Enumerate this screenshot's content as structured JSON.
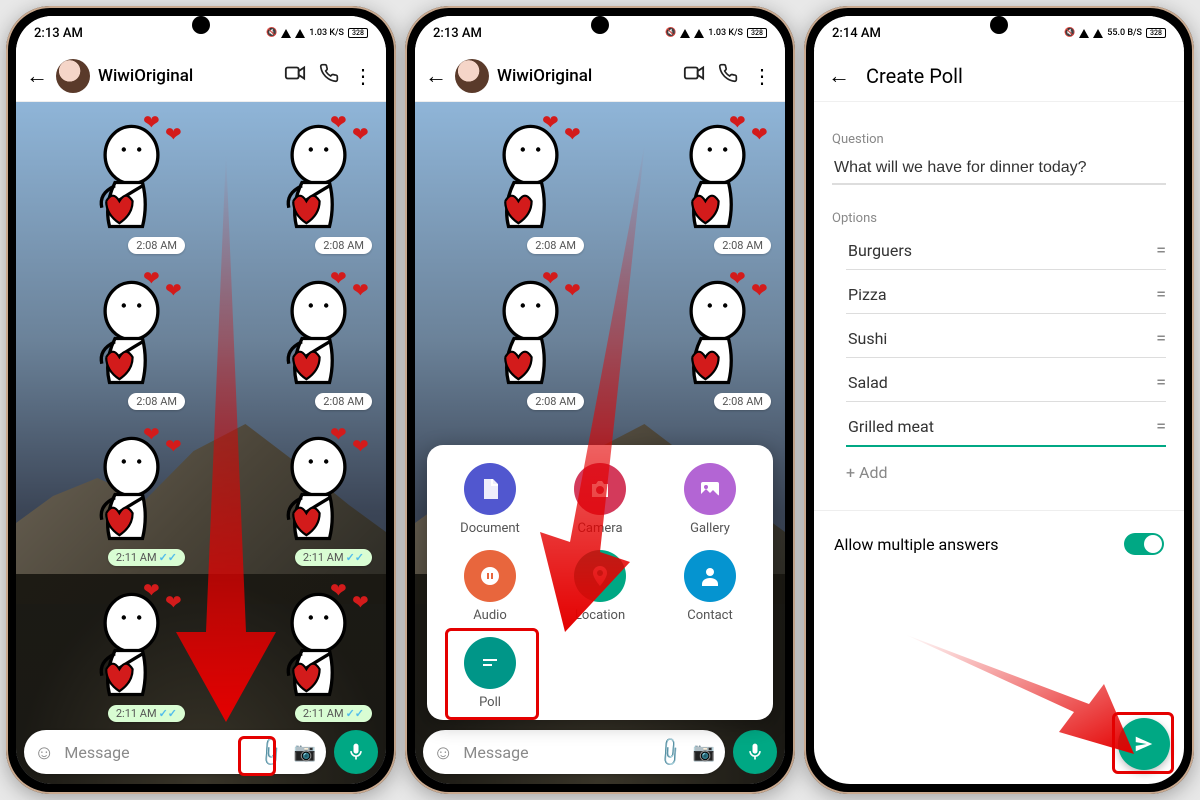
{
  "status": {
    "time12": "2:13 AM",
    "time3": "2:14 AM",
    "net1": "1.03 K/S",
    "net3": "55.0 B/S",
    "batt": "328"
  },
  "chat": {
    "contact": "WiwiOriginal",
    "placeholder": "Message",
    "times": {
      "r1": "2:08 AM",
      "r2": "2:08 AM",
      "r3": "2:11 AM",
      "r4": "2:11 AM"
    }
  },
  "attach": {
    "document": "Document",
    "camera": "Camera",
    "gallery": "Gallery",
    "audio": "Audio",
    "location": "Location",
    "contact": "Contact",
    "poll": "Poll"
  },
  "poll": {
    "title": "Create Poll",
    "question_label": "Question",
    "question_value": "What will we have for dinner today?",
    "options_label": "Options",
    "options": [
      "Burguers",
      "Pizza",
      "Sushi",
      "Salad",
      "Grilled meat"
    ],
    "add": "+ Add",
    "allow": "Allow multiple answers"
  }
}
